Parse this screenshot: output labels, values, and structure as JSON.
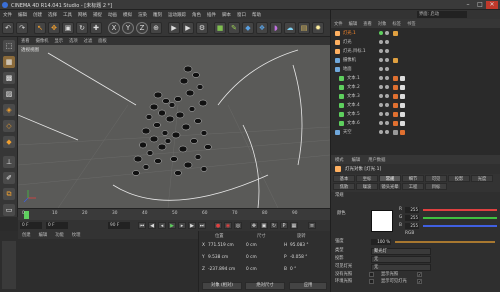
{
  "window": {
    "title": "CINEMA 4D R14.041 Studio - [未标题 2 *]",
    "min": "–",
    "max": "□",
    "close": "✕"
  },
  "menu": [
    "文件",
    "编辑",
    "创建",
    "选择",
    "工具",
    "网格",
    "捕捉",
    "动画",
    "模拟",
    "渲染",
    "雕刻",
    "运动跟踪",
    "角色",
    "插件",
    "脚本",
    "窗口",
    "帮助"
  ],
  "toolbar": {
    "axes": [
      "X",
      "Y",
      "Z"
    ]
  },
  "viewport": {
    "menu": [
      "查看",
      "摄像机",
      "显示",
      "选项",
      "过滤",
      "面板"
    ],
    "label": "透视视图"
  },
  "timeline": {
    "ticks": [
      "0",
      "10",
      "20",
      "30",
      "40",
      "50",
      "60",
      "70",
      "80",
      "90"
    ],
    "current_frame": "0 F",
    "start": "0 F",
    "end": "90 F"
  },
  "material": {
    "menu": [
      "创建",
      "编辑",
      "功能",
      "纹理"
    ]
  },
  "coordinates": {
    "headers": [
      "位置",
      "尺寸",
      "旋转"
    ],
    "rows": [
      {
        "axis": "X",
        "pos": "771.519 cm",
        "size": "0 cm",
        "rot_axis": "H",
        "rot": "95.083 °"
      },
      {
        "axis": "Y",
        "pos": "9.538 cm",
        "size": "0 cm",
        "rot_axis": "P",
        "rot": "-0.058 °"
      },
      {
        "axis": "Z",
        "pos": "-237.894 cm",
        "size": "0 cm",
        "rot_axis": "B",
        "rot": "0 °"
      }
    ],
    "mode_dropdown": "对象 (相对)",
    "size_dropdown": "绝对尺寸",
    "apply_button": "应用"
  },
  "right_panel": {
    "layout_label": "界面: 启动",
    "om_menu": [
      "文件",
      "编辑",
      "查看",
      "对象",
      "标签",
      "书签"
    ],
    "objects": [
      {
        "name": "灯光.1",
        "color": "#ffb060",
        "selected": true
      },
      {
        "name": "灯光",
        "color": "#ffb060",
        "selected": false
      },
      {
        "name": "灯光.目标.1",
        "color": "#ffb060",
        "selected": false
      },
      {
        "name": "摄像机",
        "color": "#6fa8dc",
        "selected": false
      },
      {
        "name": "地面",
        "color": "#6fa8dc",
        "selected": false
      },
      {
        "name": "文本.1",
        "color": "#5ecf5e",
        "selected": false
      },
      {
        "name": "文本.2",
        "color": "#5ecf5e",
        "selected": false
      },
      {
        "name": "文本.3",
        "color": "#5ecf5e",
        "selected": false
      },
      {
        "name": "文本.4",
        "color": "#5ecf5e",
        "selected": false
      },
      {
        "name": "文本.5",
        "color": "#5ecf5e",
        "selected": false
      },
      {
        "name": "文本.6",
        "color": "#5ecf5e",
        "selected": false
      },
      {
        "name": "天空",
        "color": "#6fa8dc",
        "selected": false
      }
    ],
    "attr_menu": [
      "模式",
      "编辑",
      "用户数据"
    ],
    "attr_header": "灯光对象 [灯光.1]",
    "subtabs_row1": [
      "基本",
      "坐标",
      "常规",
      "细节",
      "可见",
      "投影",
      "光度"
    ],
    "subtabs_row2": [
      "焦散",
      "噪波",
      "镜头光晕",
      "工程",
      "目标"
    ],
    "section": "常规",
    "color_label": "颜色",
    "rgb": [
      {
        "label": "R",
        "value": "255",
        "color": "#e04040"
      },
      {
        "label": "G",
        "value": "255",
        "color": "#40c040"
      },
      {
        "label": "B",
        "value": "255",
        "color": "#4060e0"
      }
    ],
    "rgb_mode": "RGB",
    "intensity_label": "强度",
    "intensity_value": "100 %",
    "type_label": "类型",
    "type_value": "聚光灯",
    "shadow_label": "投影",
    "shadow_value": "无",
    "visible_label": "可见灯光",
    "visible_value": "无",
    "nodiffuse_label": "没有光照",
    "envlight_label": "环境光照",
    "showlight_label": "显示光照",
    "showvisible_label": "显示可见灯光",
    "diffuse_label": "漫射",
    "specular_label": "高光",
    "gi_label": "GI照明",
    "showclip_label": "显示修剪",
    "separate_label": "分离通道"
  }
}
